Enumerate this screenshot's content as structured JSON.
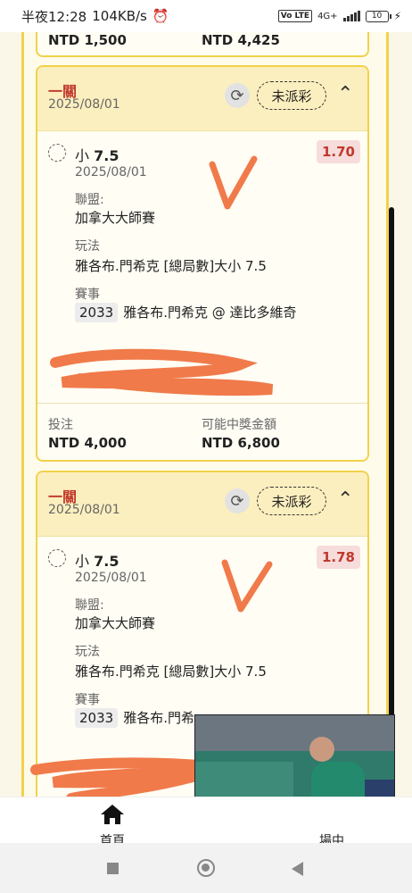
{
  "status_bar": {
    "time": "半夜12:28",
    "speed": "104KB/s",
    "volte": "Vo LTE",
    "network": "4G+",
    "battery": "10"
  },
  "prev_card": {
    "bet_amount": "NTD 1,500",
    "win_amount": "NTD 4,425"
  },
  "cards": [
    {
      "type": "一關",
      "date": "2025/08/01",
      "status": "未派彩",
      "selection": "小",
      "line": "7.5",
      "odds": "1.70",
      "selection_date": "2025/08/01",
      "league_label": "聯盟:",
      "league": "加拿大大師賽",
      "market_label": "玩法",
      "market": "雅各布.門希克 [總局數]大小 7.5",
      "event_label": "賽事",
      "event_code": "2033",
      "event": "雅各布.門希克 @ 達比多維奇",
      "bet_label": "投注",
      "bet_amount": "NTD 4,000",
      "win_label": "可能中獎金額",
      "win_amount": "NTD 6,800"
    },
    {
      "type": "一關",
      "date": "2025/08/01",
      "status": "未派彩",
      "selection": "小",
      "line": "7.5",
      "odds": "1.78",
      "selection_date": "2025/08/01",
      "league_label": "聯盟:",
      "league": "加拿大大師賽",
      "market_label": "玩法",
      "market": "雅各布.門希克 [總局數]大小 7.5",
      "event_label": "賽事",
      "event_code": "2033",
      "event": "雅各布.門希..."
    }
  ],
  "bottom_nav": {
    "home_label": "首頁",
    "right_label": "場中"
  },
  "colors": {
    "accent_border": "#f1d24a",
    "header_bg": "#fcefbf",
    "odds_red": "#c0392b",
    "scribble": "#f07a4a"
  }
}
